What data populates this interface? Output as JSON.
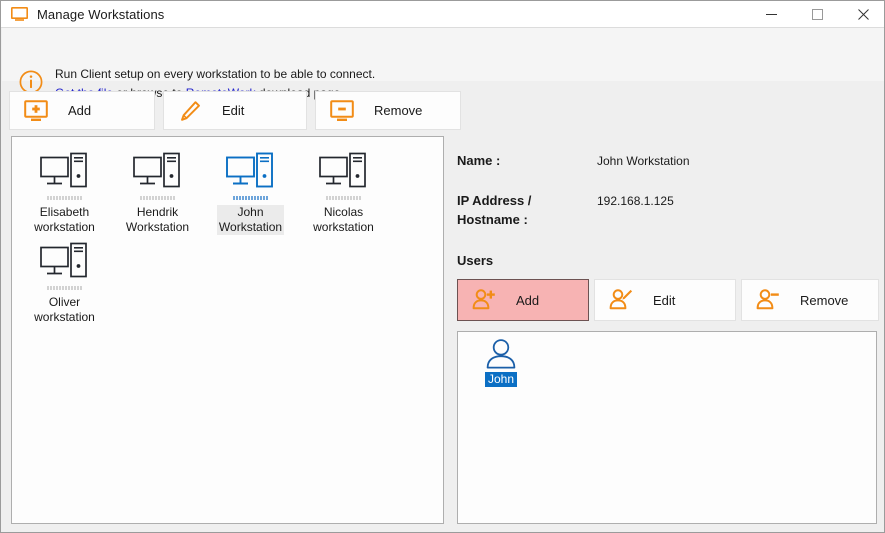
{
  "window": {
    "title": "Manage Workstations",
    "title_icon": "monitor-icon",
    "controls": {
      "minimize": "minimize-icon",
      "maximize": "maximize-icon",
      "close": "close-icon"
    }
  },
  "info_bar": {
    "icon": "info-circle-icon",
    "line1": "Run Client setup on every workstation to be able to connect.",
    "link1": "Get the file",
    "middle_text": " or browse to ",
    "link2": "RemoteWork",
    "tail_text": " download page"
  },
  "toolbar": {
    "buttons": [
      {
        "label": "Add",
        "icon": "monitor-plus-icon"
      },
      {
        "label": "Edit",
        "icon": "pencil-icon"
      },
      {
        "label": "Remove",
        "icon": "monitor-minus-icon"
      }
    ]
  },
  "workstations": {
    "items": [
      {
        "name": "Elisabeth\nworkstation",
        "line1": "Elisabeth",
        "line2": "workstation",
        "selected": false
      },
      {
        "name": "Hendrik Workstation",
        "line1": "Hendrik",
        "line2": "Workstation",
        "selected": false
      },
      {
        "name": "John Workstation",
        "line1": "John",
        "line2": "Workstation",
        "selected": true
      },
      {
        "name": "Nicolas workstation",
        "line1": "Nicolas",
        "line2": "workstation",
        "selected": false
      },
      {
        "name": "Oliver workstation",
        "line1": "Oliver",
        "line2": "workstation",
        "selected": false
      }
    ]
  },
  "detail": {
    "name_label": "Name :",
    "name_value": "John Workstation",
    "ip_label_line1": "IP Address /",
    "ip_label_line2": "Hostname :",
    "ip_value": "192.168.1.125",
    "users_heading": "Users"
  },
  "users_toolbar": {
    "buttons": [
      {
        "label": "Add",
        "icon": "user-plus-icon",
        "active": true
      },
      {
        "label": "Edit",
        "icon": "user-pencil-icon",
        "active": false
      },
      {
        "label": "Remove",
        "icon": "user-minus-icon",
        "active": false
      }
    ]
  },
  "users_list": {
    "items": [
      {
        "label": "John",
        "icon": "user-avatar-icon",
        "selected": true
      }
    ]
  },
  "colors": {
    "accent_orange": "#f28c16",
    "link_blue": "#2222cc",
    "selection_blue": "#0b6fc4",
    "active_button_bg": "#f7b3b3",
    "panel_bg": "#fdfdfd",
    "window_bg": "#efefef"
  }
}
